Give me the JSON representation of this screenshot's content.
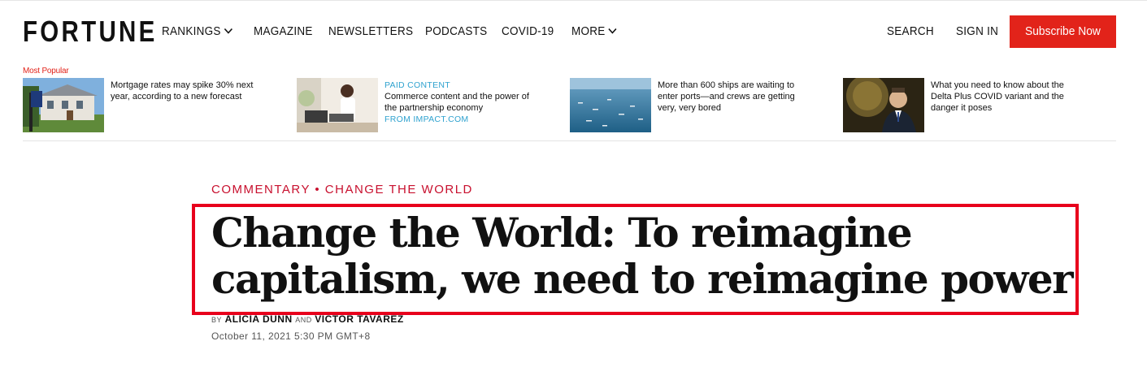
{
  "header": {
    "logo": "FORTUNE",
    "nav": [
      {
        "label": "RANKINGS"
      },
      {
        "label": "MAGAZINE"
      },
      {
        "label": "NEWSLETTERS"
      },
      {
        "label": "PODCASTS"
      },
      {
        "label": "COVID-19"
      },
      {
        "label": "MORE"
      }
    ],
    "search_label": "SEARCH",
    "signin_label": "SIGN IN",
    "subscribe_label": "Subscribe Now",
    "accent_color": "#e2231a"
  },
  "most_popular": {
    "label": "Most Popular",
    "items": [
      {
        "text": "Mortgage rates may spike 30% next year, according to a new forecast"
      },
      {
        "paid_label": "PAID CONTENT",
        "text": "Commerce content and the power of the partnership economy",
        "from": "FROM IMPACT.COM"
      },
      {
        "text": "More than 600 ships are waiting to enter ports—and crews are getting very, very bored"
      },
      {
        "text": "What you need to know about the Delta Plus COVID variant and the danger it poses"
      }
    ]
  },
  "article": {
    "category": "COMMENTARY",
    "separator": "•",
    "subcategory": "CHANGE THE WORLD",
    "headline": "Change the World: To reimagine capitalism, we need to reimagine power",
    "by": "BY",
    "author1": "ALICIA DUNN",
    "and": "AND",
    "author2": "VICTOR TAVAREZ",
    "date": "October 11, 2021 5:30 PM GMT+8"
  }
}
